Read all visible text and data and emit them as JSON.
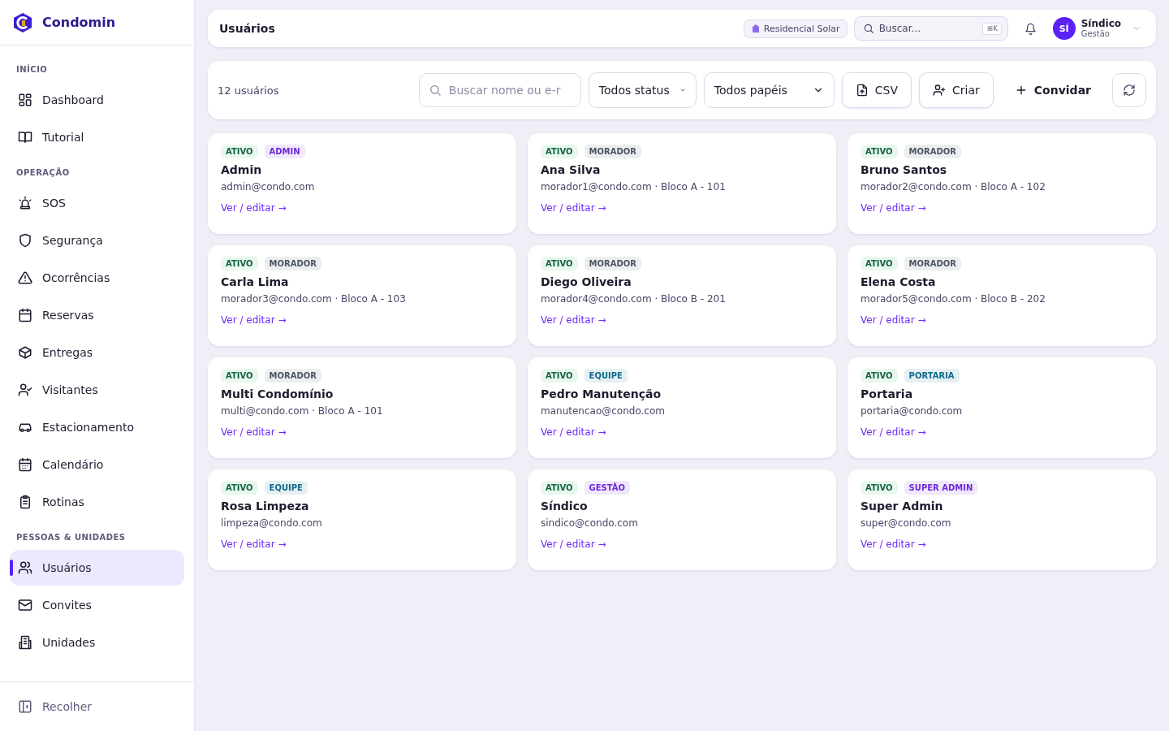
{
  "brand": {
    "name": "Condomin"
  },
  "sidebar": {
    "sections": [
      {
        "title": "INÍCIO",
        "items": [
          {
            "label": "Dashboard",
            "selected": false
          },
          {
            "label": "Tutorial",
            "selected": false
          }
        ]
      },
      {
        "title": "OPERAÇÃO",
        "items": [
          {
            "label": "SOS",
            "selected": false
          },
          {
            "label": "Segurança",
            "selected": false
          },
          {
            "label": "Ocorrências",
            "selected": false
          },
          {
            "label": "Reservas",
            "selected": false
          },
          {
            "label": "Entregas",
            "selected": false
          },
          {
            "label": "Visitantes",
            "selected": false
          },
          {
            "label": "Estacionamento",
            "selected": false
          },
          {
            "label": "Calendário",
            "selected": false
          },
          {
            "label": "Rotinas",
            "selected": false
          }
        ]
      },
      {
        "title": "PESSOAS & UNIDADES",
        "items": [
          {
            "label": "Usuários",
            "selected": true
          },
          {
            "label": "Convites",
            "selected": false
          },
          {
            "label": "Unidades",
            "selected": false
          }
        ]
      }
    ],
    "collapse": "Recolher"
  },
  "header": {
    "title": "Usuários",
    "condo": "Residencial Solar",
    "search": {
      "placeholder": "Buscar...",
      "shortcut": "⌘K"
    },
    "user": {
      "initials": "SÍ",
      "name": "Síndico",
      "role": "Gestão"
    }
  },
  "toolbar": {
    "count": "12 usuários",
    "search": {
      "placeholder": "Buscar nome ou e-r"
    },
    "status_filter": "Todos status",
    "role_filter": "Todos papéis",
    "buttons": [
      "CSV",
      "Criar",
      "Convidar"
    ]
  },
  "users": [
    {
      "status": "ATIVO",
      "role": "ADMIN",
      "color": "#6d28d9",
      "name": "Admin",
      "detail": "admin@condo.com",
      "link": "Ver / editar →"
    },
    {
      "status": "ATIVO",
      "role": "MORADOR",
      "color": "#4b5563",
      "name": "Ana Silva",
      "detail": "morador1@condo.com · Bloco A - 101",
      "link": "Ver / editar →"
    },
    {
      "status": "ATIVO",
      "role": "MORADOR",
      "color": "#4b5563",
      "name": "Bruno Santos",
      "detail": "morador2@condo.com · Bloco A - 102",
      "link": "Ver / editar →"
    },
    {
      "status": "ATIVO",
      "role": "MORADOR",
      "color": "#4b5563",
      "name": "Carla Lima",
      "detail": "morador3@condo.com · Bloco A - 103",
      "link": "Ver / editar →"
    },
    {
      "status": "ATIVO",
      "role": "MORADOR",
      "color": "#4b5563",
      "name": "Diego Oliveira",
      "detail": "morador4@condo.com · Bloco B - 201",
      "link": "Ver / editar →"
    },
    {
      "status": "ATIVO",
      "role": "MORADOR",
      "color": "#4b5563",
      "name": "Elena Costa",
      "detail": "morador5@condo.com · Bloco B - 202",
      "link": "Ver / editar →"
    },
    {
      "status": "ATIVO",
      "role": "MORADOR",
      "color": "#4b5563",
      "name": "Multi Condomínio",
      "detail": "multi@condo.com · Bloco A - 101",
      "link": "Ver / editar →"
    },
    {
      "status": "ATIVO",
      "role": "EQUIPE",
      "color": "#0e6a8c",
      "name": "Pedro Manutenção",
      "detail": "manutencao@condo.com",
      "link": "Ver / editar →"
    },
    {
      "status": "ATIVO",
      "role": "PORTARIA",
      "color": "#0e6a8c",
      "name": "Portaria",
      "detail": "portaria@condo.com",
      "link": "Ver / editar →"
    },
    {
      "status": "ATIVO",
      "role": "EQUIPE",
      "color": "#0e6a8c",
      "name": "Rosa Limpeza",
      "detail": "limpeza@condo.com",
      "link": "Ver / editar →"
    },
    {
      "status": "ATIVO",
      "role": "GESTÃO",
      "color": "#6d28d9",
      "name": "Síndico",
      "detail": "sindico@condo.com",
      "link": "Ver / editar →"
    },
    {
      "status": "ATIVO",
      "role": "SUPER ADMIN",
      "color": "#6d28d9",
      "name": "Super Admin",
      "detail": "super@condo.com",
      "link": "Ver / editar →"
    }
  ]
}
